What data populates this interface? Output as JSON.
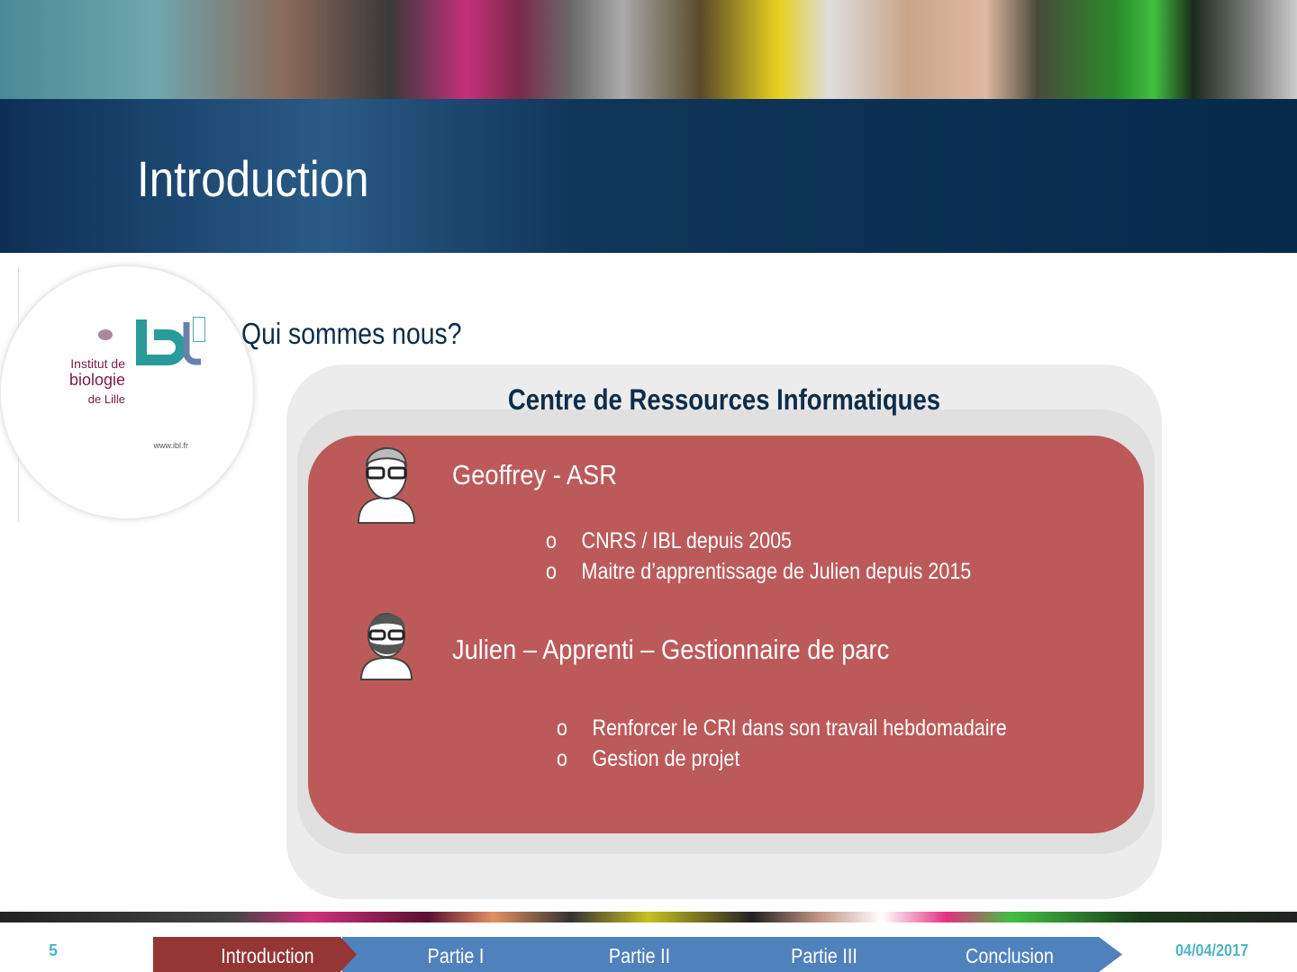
{
  "slide": {
    "title": "Introduction",
    "bullet": "Qui sommes nous?",
    "page_number": "5",
    "date": "04/04/2017"
  },
  "logo": {
    "line1": "Institut de",
    "line2": "biologie",
    "line3": "de Lille",
    "url": "www.ibl.fr",
    "mark": "ibl"
  },
  "box": {
    "title": "Centre de Ressources Informatiques",
    "people": [
      {
        "name": "Geoffrey  - ASR",
        "items": [
          "CNRS / IBL depuis 2005",
          "Maitre d’apprentissage de Julien depuis 2015"
        ]
      },
      {
        "name": "Julien – Apprenti – Gestionnaire de parc",
        "items": [
          "Renforcer le CRI dans son travail hebdomadaire",
          "Gestion de projet"
        ]
      }
    ],
    "bullet_glyph": "o"
  },
  "nav": {
    "items": [
      "Introduction",
      "Partie I",
      "Partie II",
      "Partie III",
      "Conclusion"
    ],
    "active": 0
  },
  "colors": {
    "accent": "#bc5a59",
    "nav": "#4f81bd",
    "active": "#943634",
    "navy": "#0d2d4a"
  }
}
